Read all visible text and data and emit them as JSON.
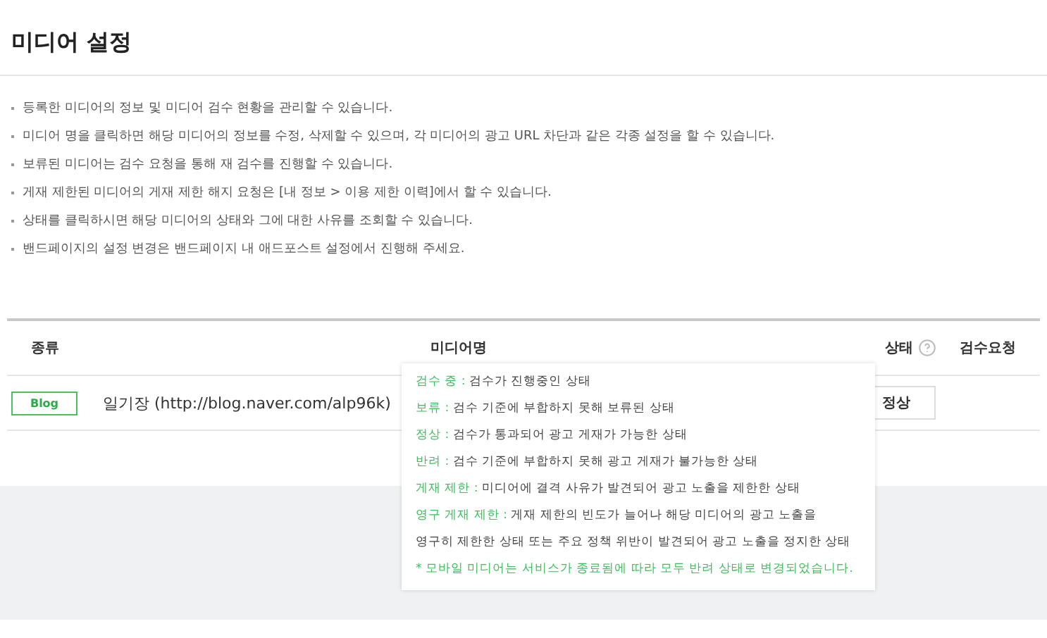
{
  "title": "미디어 설정",
  "notes": [
    "등록한 미디어의 정보 및 미디어 검수 현황을 관리할 수 있습니다.",
    "미디어 명을 클릭하면 해당 미디어의 정보를 수정, 삭제할 수 있으며, 각 미디어의 광고 URL 차단과 같은 각종 설정을 할 수 있습니다.",
    "보류된 미디어는 검수 요청을 통해 재 검수를 진행할 수 있습니다.",
    "게재 제한된 미디어의 게재 제한 해지 요청은 [내 정보 > 이용 제한 이력]에서 할 수 있습니다.",
    "상태를 클릭하시면 해당 미디어의 상태와 그에 대한 사유를 조회할 수 있습니다.",
    "밴드페이지의 설정 변경은 밴드페이지 내 애드포스트 설정에서 진행해 주세요."
  ],
  "table": {
    "columns": [
      "종류",
      "미디어명",
      "상태",
      "검수요청"
    ],
    "rows": [
      {
        "type": "Blog",
        "name": "일기장 (http://blog.naver.com/alp96k)",
        "status": "정상"
      }
    ]
  },
  "status_tooltip": {
    "items": [
      {
        "label": "검수 중 :",
        "lines": [
          "검수가 진행중인 상태"
        ]
      },
      {
        "label": "보류 :",
        "lines": [
          "검수 기준에 부합하지 못해 보류된 상태"
        ]
      },
      {
        "label": "정상 :",
        "lines": [
          "검수가 통과되어 광고 게재가 가능한 상태"
        ]
      },
      {
        "label": "반려 :",
        "lines": [
          "검수 기준에 부합하지 못해 광고 게재가 불가능한 상태"
        ]
      },
      {
        "label": "게재 제한 :",
        "lines": [
          "미디어에 결격 사유가 발견되어 광고 노출을 제한한 상태"
        ]
      },
      {
        "label": "영구 게재 제한 :",
        "lines": [
          "게재 제한의 빈도가 늘어나 해당 미디어의 광고 노출을",
          "영구히 제한한 상태 또는 주요 정책 위반이 발견되어 광고 노출을 정지한 상태"
        ]
      }
    ],
    "footnote": "* 모바일 미디어는 서비스가 종료됨에 따라 모두 반려 상태로 변경되었습니다."
  }
}
